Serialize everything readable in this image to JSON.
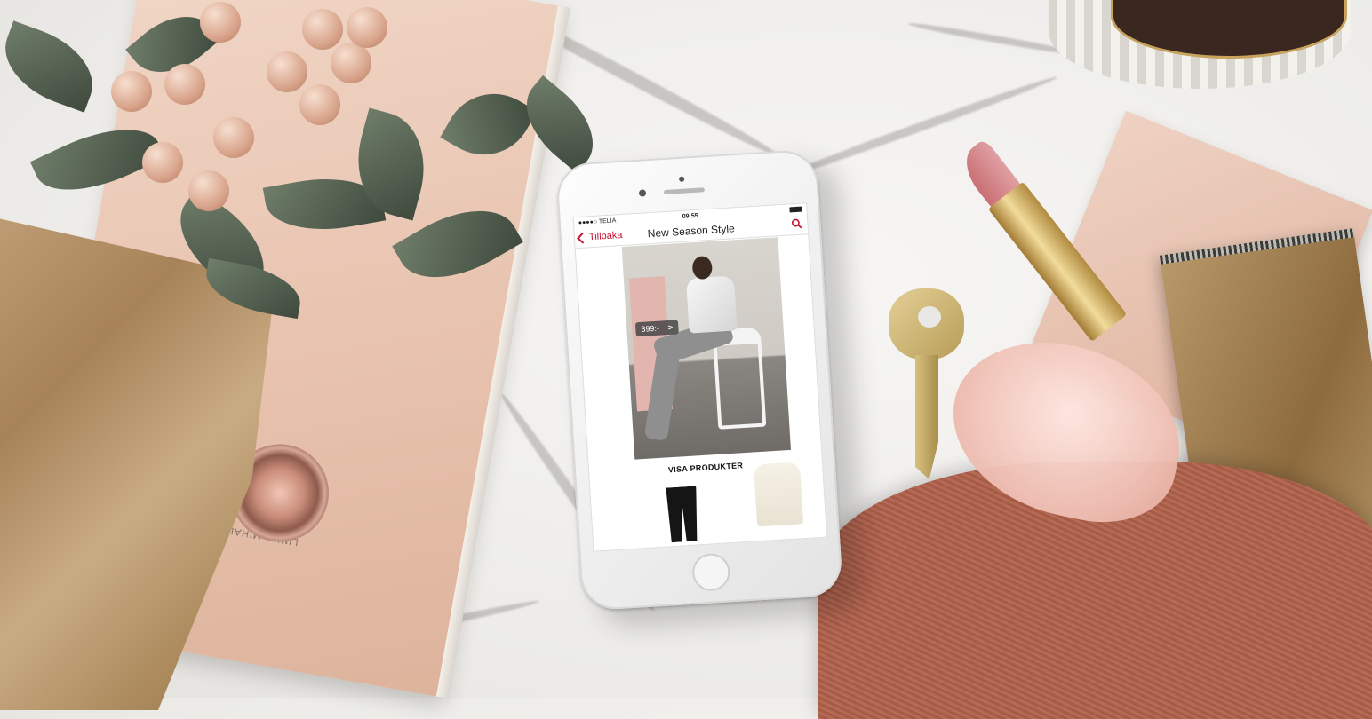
{
  "scene": {
    "book_text": "LINKO MIHALIK IN CELINE"
  },
  "app": {
    "status": {
      "carrier": "●●●●○ TELIA",
      "time": "09:55"
    },
    "nav": {
      "back_label": "Tillbaka",
      "title": "New Season Style"
    },
    "hero": {
      "price": "399:-",
      "price_arrow": ">"
    },
    "cta_label": "VISA PRODUKTER",
    "accent_color": "#c8102e",
    "icons": [
      "chevron-left-icon",
      "search-icon",
      "battery-icon",
      "wifi-icon"
    ]
  }
}
